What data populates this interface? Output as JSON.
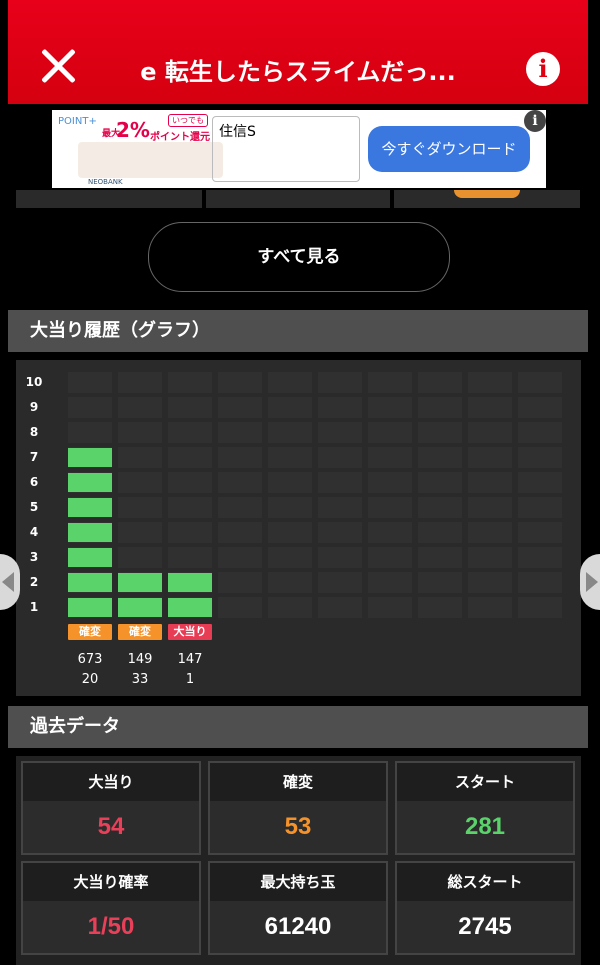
{
  "header": {
    "title": "e 転生したらスライムだっ...",
    "close_icon": "close-icon",
    "info_icon": "info-icon"
  },
  "ad": {
    "logo": "POINT+",
    "anytime": "いつでも",
    "percent": "2%",
    "promo_text": "ポイント還元",
    "max_prefix": "最大",
    "bank": "NEOBANK",
    "input_value": "住信S",
    "cta": "今すぐダウンロード"
  },
  "see_all": "すべて見る",
  "graph_section": {
    "title": "大当り履歴（グラフ）",
    "y_ticks": [
      "10",
      "9",
      "8",
      "7",
      "6",
      "5",
      "4",
      "3",
      "2",
      "1"
    ],
    "columns": [
      {
        "level": 7,
        "tag": "確変",
        "tag_color": "#f5922a",
        "line1": "673",
        "line2": "20"
      },
      {
        "level": 2,
        "tag": "確変",
        "tag_color": "#f5922a",
        "line1": "149",
        "line2": "33"
      },
      {
        "level": 2,
        "tag": "大当り",
        "tag_color": "#e73c54",
        "line1": "147",
        "line2": "1"
      }
    ],
    "bar_color": "#5ad36a"
  },
  "past_data": {
    "title": "過去データ",
    "cells": [
      {
        "label": "大当り",
        "value": "54",
        "color": "#e9405a"
      },
      {
        "label": "確変",
        "value": "53",
        "color": "#f5922a"
      },
      {
        "label": "スタート",
        "value": "281",
        "color": "#5ad36a"
      },
      {
        "label": "大当り確率",
        "value": "1/50",
        "color": "#e9405a"
      },
      {
        "label": "最大持ち玉",
        "value": "61240",
        "color": "#ffffff"
      },
      {
        "label": "総スタート",
        "value": "2745",
        "color": "#ffffff"
      }
    ]
  }
}
